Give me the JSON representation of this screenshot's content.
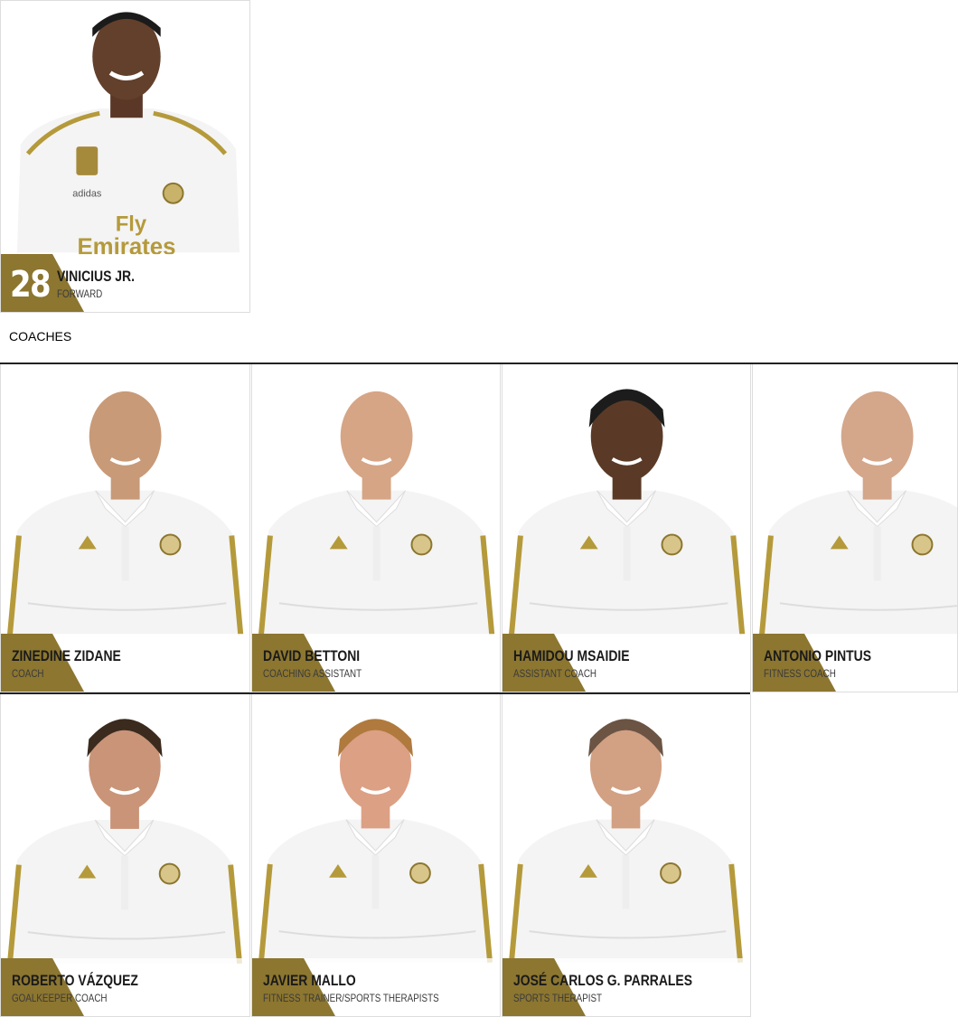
{
  "colors": {
    "gold": "#8c7630",
    "caption_bg": "#ffffff",
    "kit": "#f4f4f4",
    "trim": "#b59a3b"
  },
  "player": {
    "number": "28",
    "name": "VINICIUS JR.",
    "role": "FORWARD",
    "kit_text_1": "Fly",
    "kit_text_2": "Emirates",
    "kit_brand": "adidas"
  },
  "coaches_heading": "COACHES",
  "coaches": [
    {
      "name": "ZINEDINE ZIDANE",
      "role": "COACH",
      "skin": "#c89a78",
      "hair": "none"
    },
    {
      "name": "DAVID BETTONI",
      "role": "COACHING ASSISTANT",
      "skin": "#d6a585",
      "hair": "none"
    },
    {
      "name": "HAMIDOU MSAIDIE",
      "role": "ASSISTANT COACH",
      "skin": "#5a3a27",
      "hair": "#1c1c1c"
    },
    {
      "name": "ANTONIO PINTUS",
      "role": "FITNESS COACH",
      "skin": "#d4a68a",
      "hair": "none"
    },
    {
      "name": "ROBERTO VÁZQUEZ",
      "role": "GOALKEEPER COACH",
      "skin": "#c99478",
      "hair": "#3b2a1e"
    },
    {
      "name": "JAVIER MALLO",
      "role": "FITNESS TRAINER/SPORTS THERAPISTS",
      "skin": "#dca085",
      "hair": "#b07a3e"
    },
    {
      "name": "JOSÉ CARLOS G. PARRALES",
      "role": "SPORTS THERAPIST",
      "skin": "#d2a083",
      "hair": "#6b5443"
    }
  ]
}
